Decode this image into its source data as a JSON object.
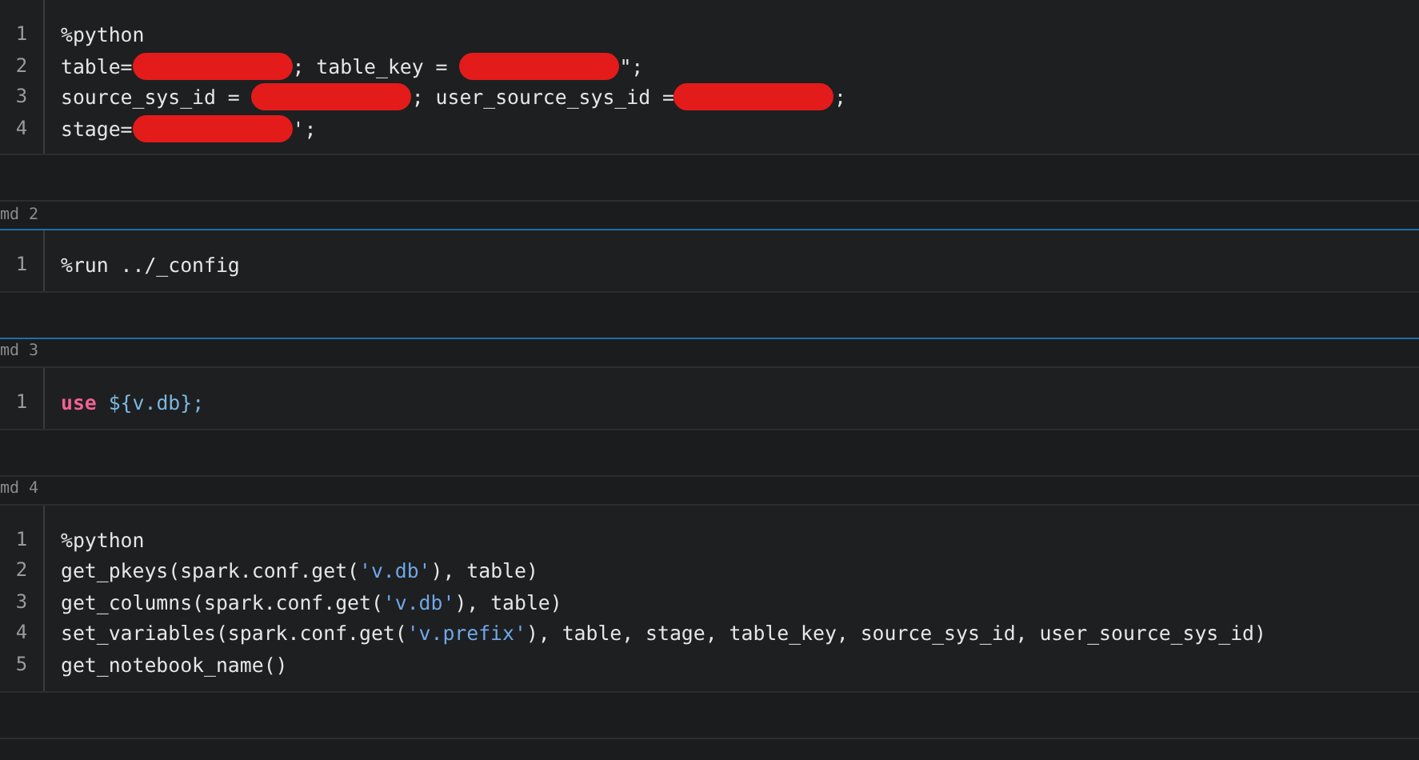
{
  "cells": [
    {
      "selected": false,
      "lines": [
        {
          "number": "1",
          "segments": [
            {
              "kind": "plain",
              "text": "%python"
            }
          ]
        },
        {
          "number": "2",
          "segments": [
            {
              "kind": "plain",
              "text": "table="
            },
            {
              "kind": "redaction"
            },
            {
              "kind": "plain",
              "text": "; table_key = "
            },
            {
              "kind": "redaction"
            },
            {
              "kind": "plain",
              "text": "\";"
            }
          ]
        },
        {
          "number": "3",
          "segments": [
            {
              "kind": "plain",
              "text": "source_sys_id = "
            },
            {
              "kind": "redaction"
            },
            {
              "kind": "plain",
              "text": "; user_source_sys_id ="
            },
            {
              "kind": "redaction"
            },
            {
              "kind": "plain",
              "text": ";"
            }
          ]
        },
        {
          "number": "4",
          "segments": [
            {
              "kind": "plain",
              "text": "stage="
            },
            {
              "kind": "redaction"
            },
            {
              "kind": "plain",
              "text": "';"
            }
          ]
        }
      ]
    },
    {
      "label": "md 2",
      "selected": true,
      "lines": [
        {
          "number": "1",
          "segments": [
            {
              "kind": "plain",
              "text": "%run ../_config"
            }
          ]
        }
      ]
    },
    {
      "label": "md 3",
      "selected": false,
      "lines": [
        {
          "number": "1",
          "segments": [
            {
              "kind": "keyword",
              "text": "use"
            },
            {
              "kind": "variable",
              "text": " ${v.db};"
            }
          ]
        }
      ]
    },
    {
      "label": "md 4",
      "selected": false,
      "lines": [
        {
          "number": "1",
          "segments": [
            {
              "kind": "plain",
              "text": "%python"
            }
          ]
        },
        {
          "number": "2",
          "segments": [
            {
              "kind": "plain",
              "text": "get_pkeys(spark.conf.get("
            },
            {
              "kind": "string",
              "text": "'v.db'"
            },
            {
              "kind": "plain",
              "text": "), table)"
            }
          ]
        },
        {
          "number": "3",
          "segments": [
            {
              "kind": "plain",
              "text": "get_columns(spark.conf.get("
            },
            {
              "kind": "string",
              "text": "'v.db'"
            },
            {
              "kind": "plain",
              "text": "), table)"
            }
          ]
        },
        {
          "number": "4",
          "segments": [
            {
              "kind": "plain",
              "text": "set_variables(spark.conf.get("
            },
            {
              "kind": "string",
              "text": "'v.prefix'"
            },
            {
              "kind": "plain",
              "text": "), table, stage, table_key, source_sys_id, user_source_sys_id)"
            }
          ]
        },
        {
          "number": "5",
          "segments": [
            {
              "kind": "plain",
              "text": "get_notebook_name()"
            }
          ]
        }
      ]
    }
  ]
}
